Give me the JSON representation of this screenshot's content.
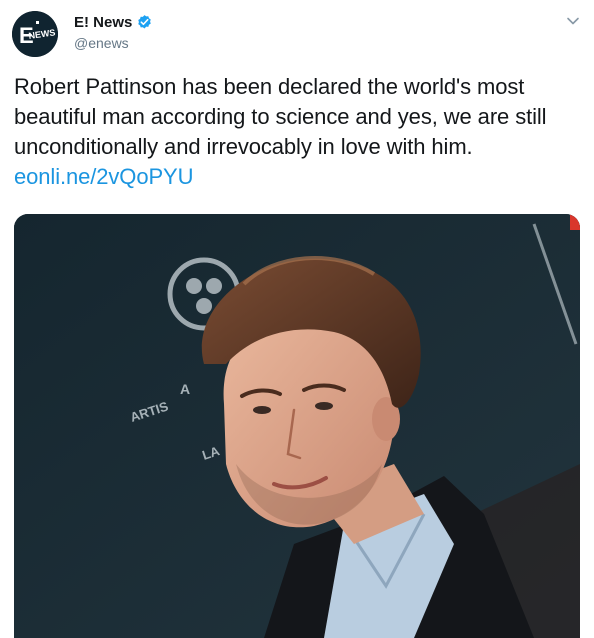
{
  "tweet": {
    "author": {
      "display_name": "E! News",
      "handle": "@enews",
      "avatar_icon": "enews-logo-avatar",
      "verified_icon": "verified-badge-icon",
      "verified_color": "#1da1f2"
    },
    "text": "Robert Pattinson has been declared the world's most beautiful man according to science and yes, we are still unconditionally and irrevocably in love with him.",
    "link": "eonli.ne/2vQoPYU",
    "link_color": "#1b95e0",
    "menu_icon": "chevron-down-icon",
    "media": {
      "type": "photo",
      "backdrop_lettering": [
        "A",
        "ARTIS",
        "LA"
      ]
    }
  }
}
